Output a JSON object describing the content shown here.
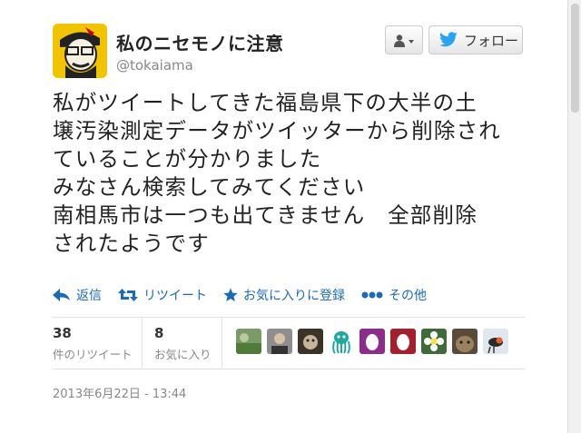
{
  "user": {
    "name": "私のニセモノに注意",
    "handle": "@tokaiama"
  },
  "buttons": {
    "follow_label": "フォロー"
  },
  "tweet": {
    "lines": [
      "私がツイートしてきた福島県下の大半の土",
      "壌汚染測定データがツイッターから削除され",
      "ていることが分かりました",
      "みなさん検索してみてください",
      "南相馬市は一つも出てきません　全部削除",
      "されたようです"
    ]
  },
  "actions": {
    "reply": "返信",
    "retweet": "リツイート",
    "favorite": "お気に入りに登録",
    "more": "その他"
  },
  "stats": {
    "retweets_count": "38",
    "retweets_label": "件のリツイート",
    "favorites_count": "8",
    "favorites_label": "お気に入り"
  },
  "timestamp": "2013年6月22日 - 13:44",
  "colors": {
    "link": "#1a6bb5",
    "twitter_bird": "#2aa3ef"
  },
  "icons": [
    "user-dropdown-icon",
    "twitter-bird-icon",
    "reply-icon",
    "retweet-icon",
    "star-icon",
    "more-dots-icon"
  ]
}
